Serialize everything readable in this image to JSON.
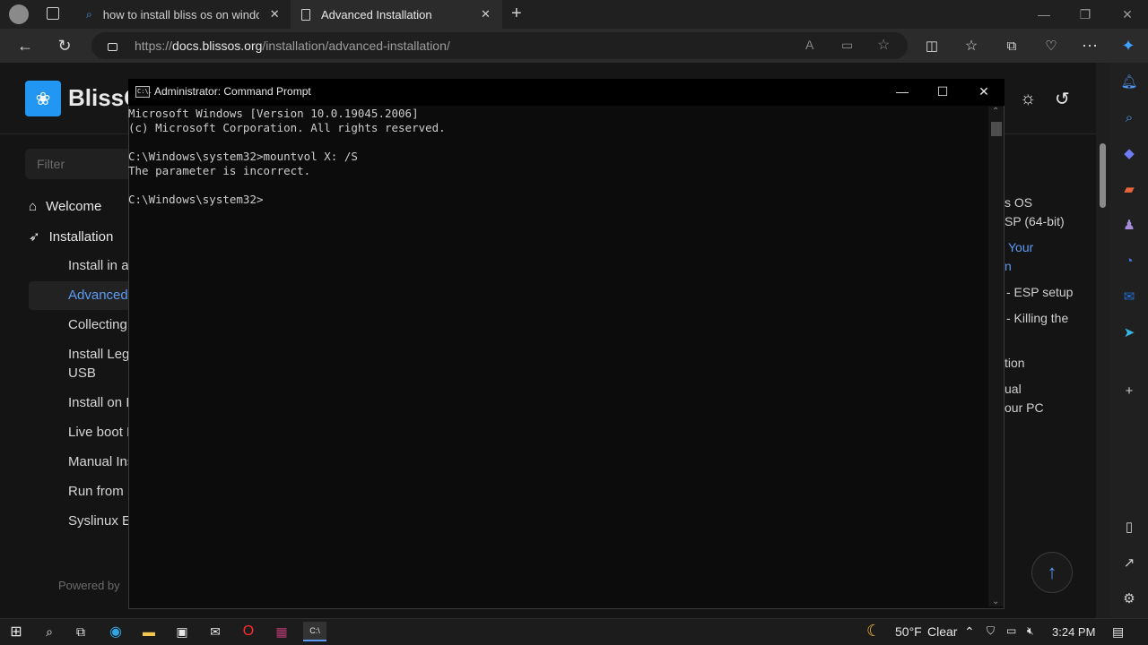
{
  "browser": {
    "tabs": [
      {
        "title": "how to install bliss os on window"
      },
      {
        "title": "Advanced Installation"
      }
    ],
    "address": {
      "scheme": "https://",
      "host": "docs.blissos.org",
      "path": "/installation/advanced-installation/"
    }
  },
  "site": {
    "brand": "BlissO",
    "filter_placeholder": "Filter",
    "nav": {
      "welcome": "Welcome",
      "installation": "Installation",
      "items": [
        "Install in a",
        "Advanced",
        "Collecting",
        "Install Leg",
        "USB",
        "Install on I",
        "Live boot I",
        "Manual Ins",
        "Run from I",
        "Syslinux E"
      ]
    },
    "footer": "Powered by",
    "toc": [
      "s OS",
      "SP (64-bit)",
      "Your",
      "n",
      "- ESP setup",
      "- Killing the",
      "tion",
      "ual",
      "our PC"
    ]
  },
  "cmd": {
    "title": "Administrator: Command Prompt",
    "icon_text": "C:\\.",
    "lines": [
      "Microsoft Windows [Version 10.0.19045.2006]",
      "(c) Microsoft Corporation. All rights reserved.",
      "",
      "C:\\Windows\\system32>mountvol X: /S",
      "The parameter is incorrect.",
      "",
      "C:\\Windows\\system32>"
    ]
  },
  "taskbar": {
    "weather_temp": "50°F",
    "weather_cond": "Clear",
    "time": "3:24 PM"
  },
  "colors": {
    "accent": "#5b9cf2",
    "console_text": "#cccccc"
  }
}
